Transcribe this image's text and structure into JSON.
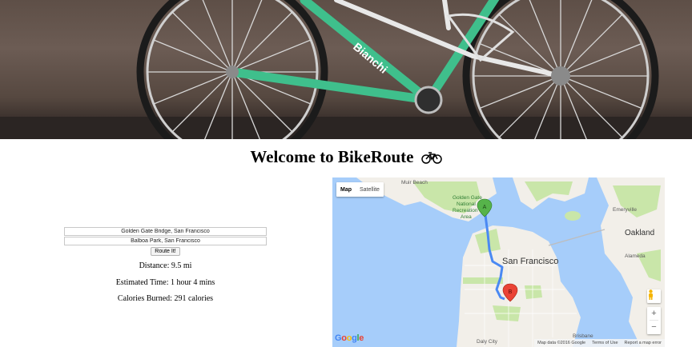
{
  "page": {
    "title": "Welcome to BikeRoute",
    "title_icon": "bicycle-icon"
  },
  "hero": {
    "icon": "bicycle-photo"
  },
  "form": {
    "origin_value": "Golden Gate Bridge, San Francisco",
    "destination_value": "Balboa Park, San Francisco",
    "route_button": "Route It!"
  },
  "results": {
    "distance": "Distance: 9.5 mi",
    "time": "Estimated Time: 1 hour 4 mins",
    "calories": "Calories Burned: 291 calories"
  },
  "map": {
    "type_map": "Map",
    "type_satellite": "Satellite",
    "marker_a": "A",
    "marker_b": "B",
    "zoom_in": "+",
    "zoom_out": "−",
    "logo": "Google",
    "attribution": "Map data ©2016 Google",
    "terms": "Terms of Use",
    "report": "Report a map error",
    "labels": {
      "muir_beach": "Muir Beach",
      "golden_gate": "Golden Gate",
      "national": "National",
      "recreation": "Recreation",
      "area": "Area",
      "san_francisco": "San Francisco",
      "emeryville": "Emeryville",
      "oakland": "Oakland",
      "alameda": "Alameda",
      "daly_city": "Daly City",
      "brisbane": "Brisbane"
    },
    "colors": {
      "water": "#a6cdfa",
      "land": "#f2efe9",
      "park": "#c9e6a9",
      "route": "#4a89f3",
      "marker_a": "#56b34a",
      "marker_b": "#ea4335"
    }
  }
}
